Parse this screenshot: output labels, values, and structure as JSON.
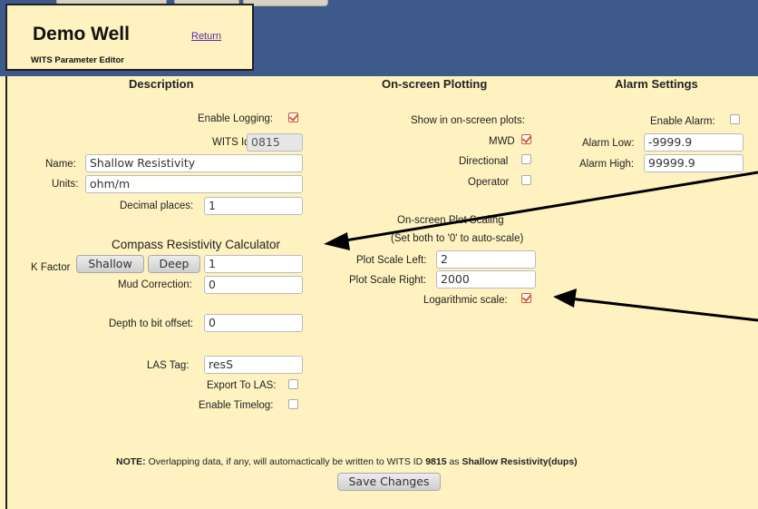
{
  "title": "Demo Well",
  "return_link": "Return",
  "subtitle": "WITS Parameter Editor",
  "headers": {
    "description": "Description",
    "plotting": "On-screen Plotting",
    "alarm": "Alarm Settings"
  },
  "description": {
    "enable_logging_label": "Enable Logging:",
    "enable_logging": true,
    "wits_id_label": "WITS Id:",
    "wits_id": "0815",
    "name_label": "Name:",
    "name": "Shallow Resistivity",
    "units_label": "Units:",
    "units": "ohm/m",
    "decimal_label": "Decimal places:",
    "decimal": "1"
  },
  "calculator": {
    "title": "Compass Resistivity Calculator",
    "k_factor_label": "K Factor",
    "shallow_button": "Shallow",
    "deep_button": "Deep",
    "k_factor": "1",
    "mud_label": "Mud Correction:",
    "mud": "0"
  },
  "depth_offset_label": "Depth to bit offset:",
  "depth_offset": "0",
  "las": {
    "tag_label": "LAS Tag:",
    "tag": "resS",
    "export_label": "Export To LAS:",
    "export": false,
    "timelog_label": "Enable Timelog:",
    "timelog": false
  },
  "plotting": {
    "show_label": "Show in on-screen plots:",
    "mwd_label": "MWD",
    "mwd": true,
    "directional_label": "Directional",
    "directional": false,
    "operator_label": "Operator",
    "operator": false,
    "scaling_label": "On-screen Plot Scaling",
    "scaling_hint": "(Set both to '0' to auto-scale)",
    "left_label": "Plot Scale Left:",
    "left": "2",
    "right_label": "Plot Scale Right:",
    "right": "2000",
    "log_label": "Logarithmic scale:",
    "log": true
  },
  "alarm": {
    "enable_label": "Enable Alarm:",
    "enable": false,
    "low_label": "Alarm Low:",
    "low": "-9999.9",
    "high_label": "Alarm High:",
    "high": "99999.9"
  },
  "note": {
    "prefix": "NOTE:",
    "text": " Overlapping data, if any, will automactically be written to WITS ID ",
    "id": "9815",
    "mid": " as ",
    "name": "Shallow Resistivity(dups)"
  },
  "save_button": "Save Changes"
}
